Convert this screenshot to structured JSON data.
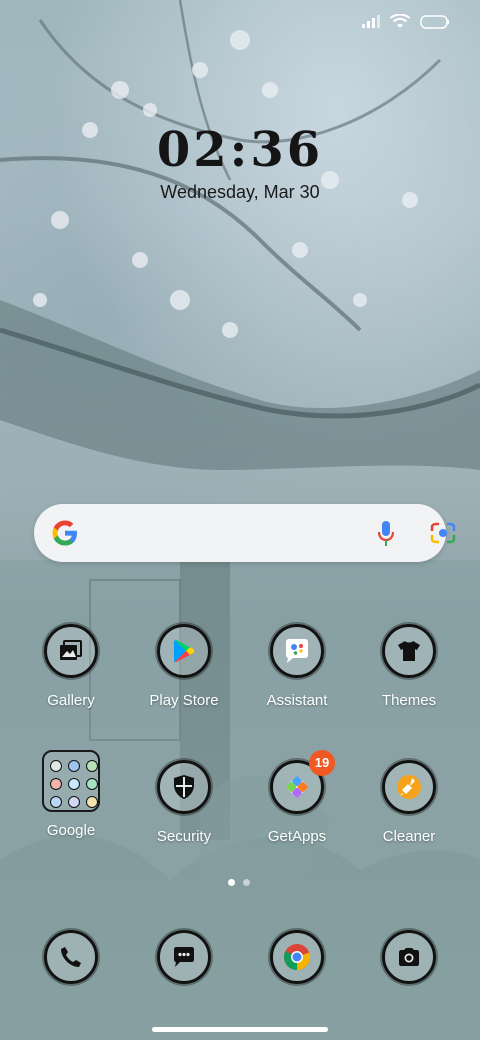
{
  "status_bar": {
    "signal_icon": "signal-icon",
    "wifi_icon": "wifi-icon",
    "battery_icon": "battery-icon"
  },
  "clock": {
    "time": "02:36",
    "date": "Wednesday, Mar 30"
  },
  "search_widget": {
    "logo_icon": "google-g-icon",
    "mic_icon": "mic-icon",
    "lens_icon": "lens-icon"
  },
  "apps_row1": [
    {
      "label": "Gallery",
      "icon": "gallery-icon"
    },
    {
      "label": "Play Store",
      "icon": "play-store-icon"
    },
    {
      "label": "Assistant",
      "icon": "assistant-icon"
    },
    {
      "label": "Themes",
      "icon": "themes-icon"
    }
  ],
  "apps_row2": [
    {
      "label": "Google",
      "icon": "folder-icon"
    },
    {
      "label": "Security",
      "icon": "security-icon"
    },
    {
      "label": "GetApps",
      "icon": "getapps-icon",
      "badge": "19"
    },
    {
      "label": "Cleaner",
      "icon": "cleaner-icon"
    }
  ],
  "dock": [
    {
      "icon": "phone-icon"
    },
    {
      "icon": "messages-icon"
    },
    {
      "icon": "chrome-icon"
    },
    {
      "icon": "camera-icon"
    }
  ],
  "page_indicator": {
    "pages": 2,
    "current": 1
  },
  "colors": {
    "badge": "#f05a22",
    "label_text": "#ffffff"
  }
}
